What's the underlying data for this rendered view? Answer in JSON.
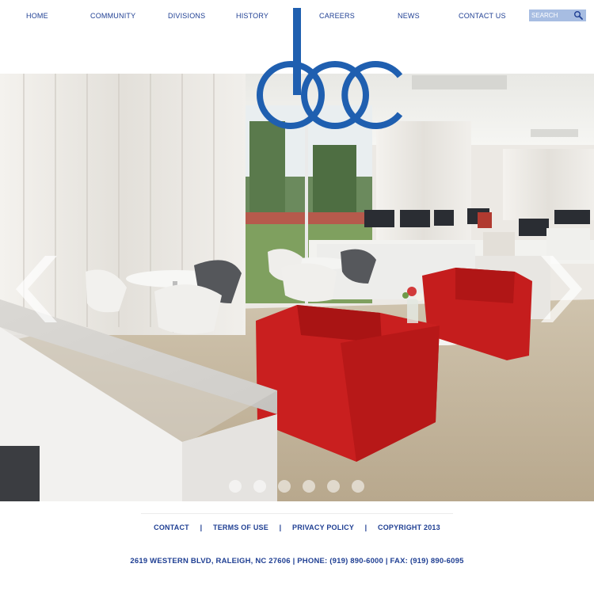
{
  "nav": {
    "items": [
      {
        "label": "HOME"
      },
      {
        "label": "COMMUNITY"
      },
      {
        "label": "DIVISIONS"
      },
      {
        "label": "HISTORY"
      },
      {
        "label": "CAREERS"
      },
      {
        "label": "NEWS"
      },
      {
        "label": "CONTACT US"
      }
    ],
    "search_placeholder": "SEARCH"
  },
  "logo": {
    "letters": "dcc",
    "color": "#1f5fb0"
  },
  "carousel": {
    "slide_count": 6,
    "prev_icon": "chevron-left-icon",
    "next_icon": "chevron-right-icon"
  },
  "footer": {
    "links": [
      {
        "label": "CONTACT"
      },
      {
        "label": "TERMS OF USE"
      },
      {
        "label": "PRIVACY POLICY"
      },
      {
        "label": "COPYRIGHT 2013"
      }
    ],
    "separator": "|",
    "address": "2619 WESTERN BLVD, RALEIGH, NC 27606 | PHONE: (919) 890-6000 | FAX: (919) 890-6095"
  },
  "colors": {
    "brand": "#1f3f93",
    "logo": "#1f5fb0",
    "search_bg": "#a7bde2"
  }
}
